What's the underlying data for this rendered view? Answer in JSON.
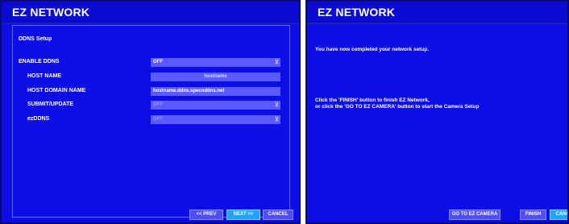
{
  "left": {
    "title": "EZ NETWORK",
    "section": "DDNS Setup",
    "rows": [
      {
        "label": "ENABLE DDNS",
        "value": "OFF"
      },
      {
        "label": "HOST NAME",
        "value": "hostname"
      },
      {
        "label": "HOST DOMAIN NAME",
        "value": "hostname.ddns.specoddns.net"
      },
      {
        "label": "SUBMIT/UPDATE",
        "value": "OFF"
      },
      {
        "label": "ezDDNS",
        "value": "OFF"
      }
    ],
    "buttons": {
      "prev": "<< PREV",
      "next": "NEXT >>",
      "cancel": "CANCEL"
    }
  },
  "right": {
    "title": "EZ NETWORK",
    "message1": "You have now completed your network setup.",
    "message2": "Click the 'FINISH' button to finish EZ Network,",
    "message3": "or click the 'GO TO EZ CAMERA' button to start the Camera Setup",
    "buttons": {
      "go_camera": "GO TO EZ CAMERA",
      "finish": "FINISH",
      "cancel": "CANCEL"
    }
  },
  "icons": {
    "dropdown": "chevron-down-icon"
  },
  "colors": {
    "background": "#0d0de6",
    "field": "#5a5aff",
    "active_button": "#1fa4ff"
  }
}
